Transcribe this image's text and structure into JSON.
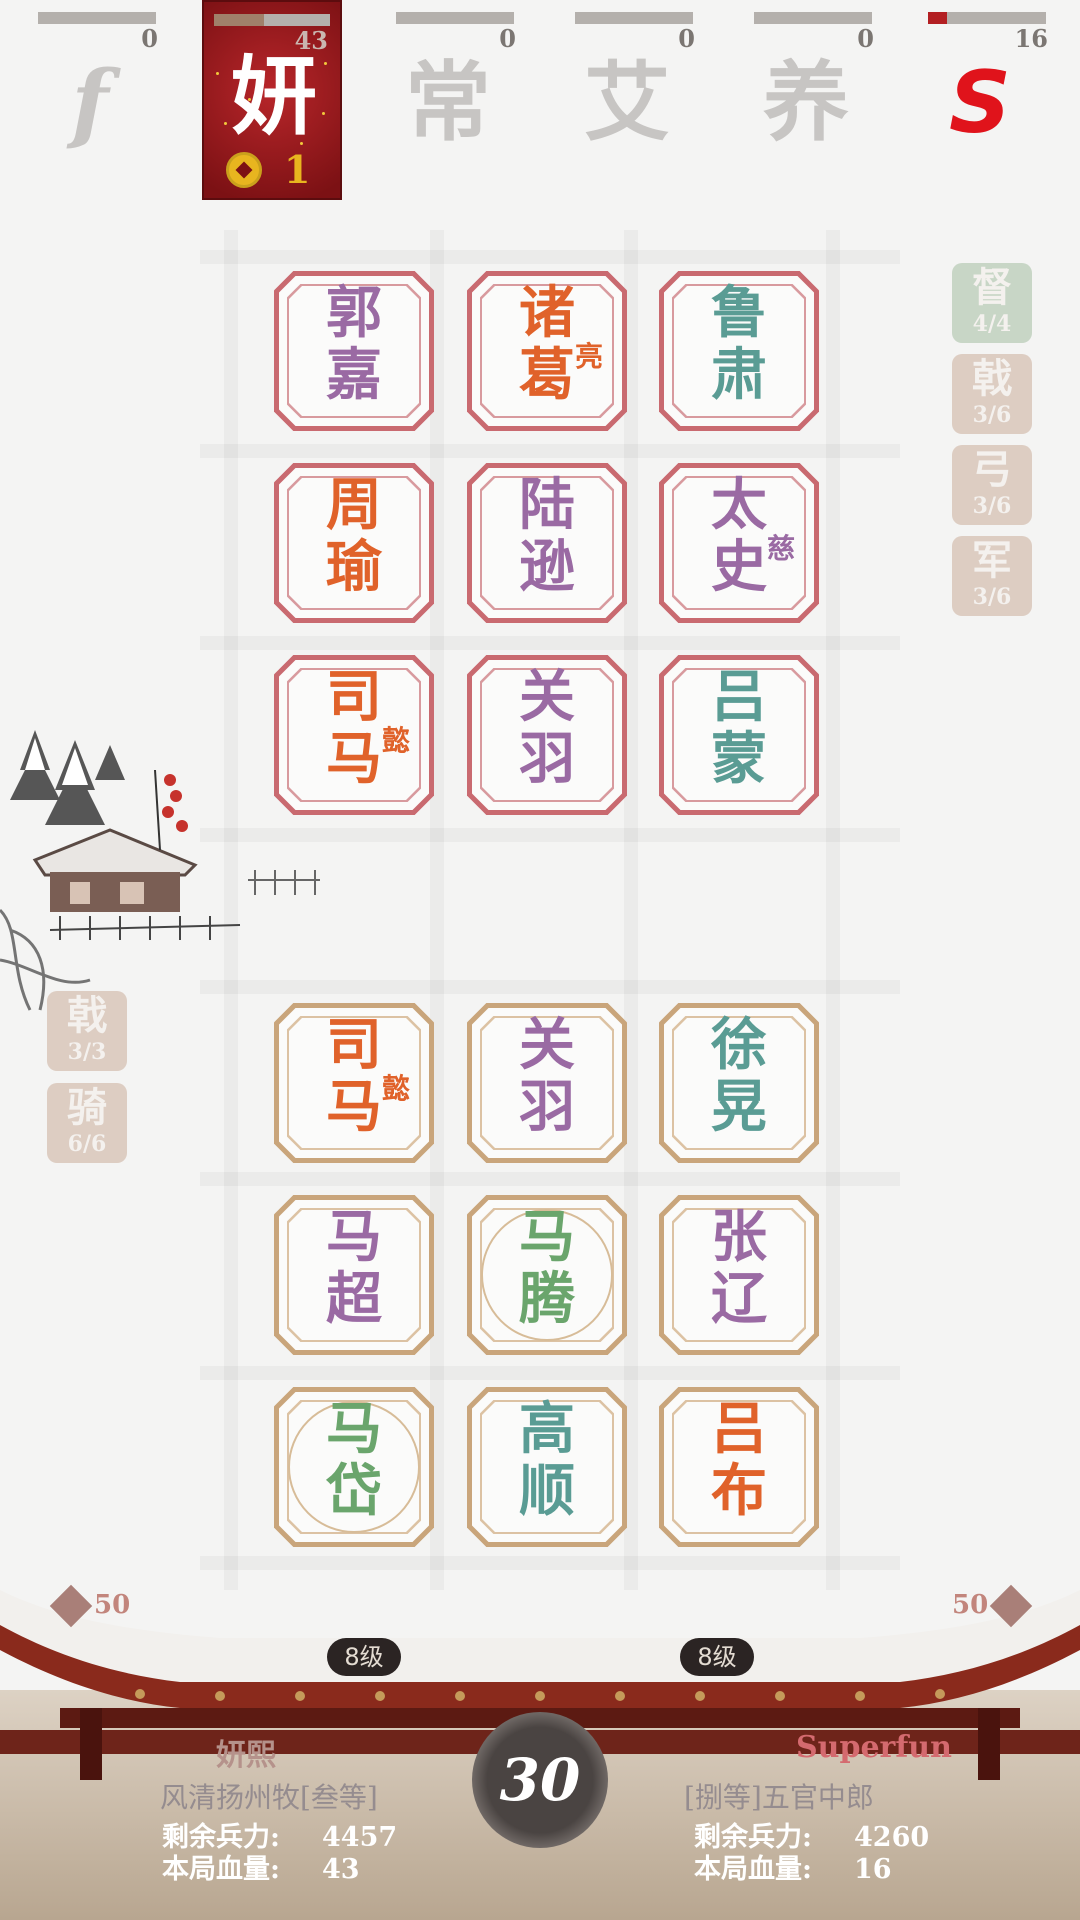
{
  "players": [
    {
      "glyph": "f",
      "hp": "0",
      "hp_fraction": 0,
      "bar_color": "#b4b0ac",
      "active": false
    },
    {
      "glyph": "妍",
      "hp": "43",
      "hp_fraction": 0.43,
      "bar_color": "#a0806a",
      "active": true,
      "coins": "1"
    },
    {
      "glyph": "常",
      "hp": "0",
      "hp_fraction": 0,
      "bar_color": "#b4b0ac",
      "active": false
    },
    {
      "glyph": "艾",
      "hp": "0",
      "hp_fraction": 0,
      "bar_color": "#b4b0ac",
      "active": false
    },
    {
      "glyph": "养",
      "hp": "0",
      "hp_fraction": 0,
      "bar_color": "#b4b0ac",
      "active": false
    },
    {
      "glyph": "S",
      "hp": "16",
      "hp_fraction": 0.16,
      "bar_color": "#b31f22",
      "active": false
    }
  ],
  "enemy_cards": [
    {
      "name": "郭嘉",
      "sub": "",
      "color": "#9a6aa3"
    },
    {
      "name": "诸葛",
      "sub": "亮",
      "color": "#e0622a"
    },
    {
      "name": "鲁肃",
      "sub": "",
      "color": "#5a9c94"
    },
    {
      "name": "周瑜",
      "sub": "",
      "color": "#e0622a"
    },
    {
      "name": "陆逊",
      "sub": "",
      "color": "#9a6aa3"
    },
    {
      "name": "太史",
      "sub": "慈",
      "color": "#9a6aa3"
    },
    {
      "name": "司马",
      "sub": "懿",
      "color": "#e0622a"
    },
    {
      "name": "关羽",
      "sub": "",
      "color": "#9a6aa3"
    },
    {
      "name": "吕蒙",
      "sub": "",
      "color": "#5a9c94"
    }
  ],
  "my_cards": [
    {
      "name": "司马",
      "sub": "懿",
      "color": "#e0622a",
      "circle": false
    },
    {
      "name": "关羽",
      "sub": "",
      "color": "#9a6aa3",
      "circle": false
    },
    {
      "name": "徐晃",
      "sub": "",
      "color": "#5a9c94",
      "circle": false
    },
    {
      "name": "马超",
      "sub": "",
      "color": "#9a6aa3",
      "circle": false
    },
    {
      "name": "马腾",
      "sub": "",
      "color": "#6aa56c",
      "circle": true
    },
    {
      "name": "张辽",
      "sub": "",
      "color": "#9a6aa3",
      "circle": false
    },
    {
      "name": "马岱",
      "sub": "",
      "color": "#6aa56c",
      "circle": true
    },
    {
      "name": "高顺",
      "sub": "",
      "color": "#5a9c94",
      "circle": false
    },
    {
      "name": "吕布",
      "sub": "",
      "color": "#e0622a",
      "circle": false
    }
  ],
  "enemy_badges": [
    {
      "name": "督",
      "count": "4/4",
      "style": "green"
    },
    {
      "name": "戟",
      "count": "3/6",
      "style": "tan"
    },
    {
      "name": "弓",
      "count": "3/6",
      "style": "tan"
    },
    {
      "name": "军",
      "count": "3/6",
      "style": "tan"
    }
  ],
  "my_badges": [
    {
      "name": "戟",
      "count": "3/3",
      "style": "tan"
    },
    {
      "name": "骑",
      "count": "6/6",
      "style": "tan"
    }
  ],
  "bottom": {
    "left_power": "50",
    "right_power": "50",
    "left_level": "8级",
    "right_level": "8级",
    "timer": "30",
    "left_player": {
      "name": "妍熙",
      "title": "风清扬州牧[叁等]",
      "troops_label": "剩余兵力:",
      "troops": "4457",
      "hp_label": "本局血量:",
      "hp": "43"
    },
    "right_player": {
      "name": "Superfun",
      "title": "[捌等]五官中郎",
      "troops_label": "剩余兵力:",
      "troops": "4260",
      "hp_label": "本局血量:",
      "hp": "16"
    }
  },
  "colors": {
    "active_bg": "#9a1b1f",
    "enemy_card_border": "#c96a70",
    "my_card_border": "#c9a57b",
    "left_name": "#b5928b",
    "right_name": "#d46a6f"
  }
}
